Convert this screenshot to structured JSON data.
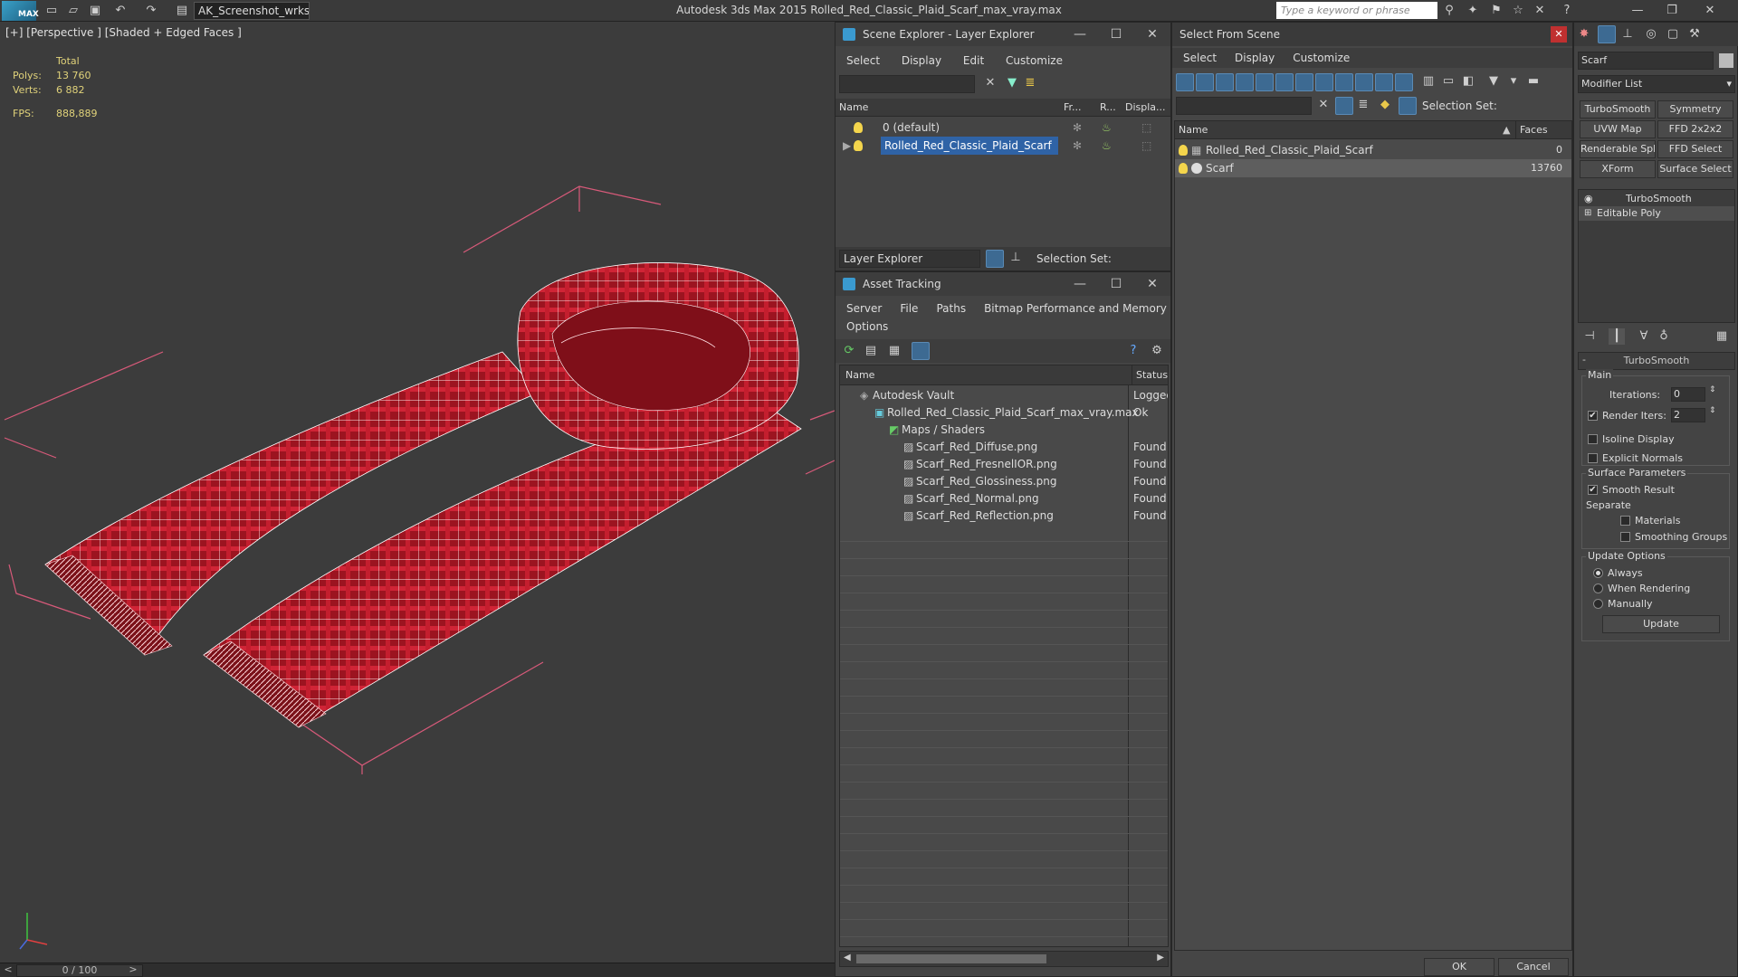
{
  "titlebar": {
    "workspace": "AK_Screenshot_wrksp",
    "title": "Autodesk 3ds Max  2015    Rolled_Red_Classic_Plaid_Scarf_max_vray.max",
    "search_placeholder": "Type a keyword or phrase"
  },
  "viewport": {
    "label": "[+] [Perspective ] [Shaded + Edged Faces ]",
    "stats": {
      "total_label": "Total",
      "polys_label": "Polys:",
      "polys_value": "13 760",
      "verts_label": "Verts:",
      "verts_value": "6 882",
      "fps_label": "FPS:",
      "fps_value": "888,889"
    },
    "timeline": "0 / 100"
  },
  "scene_explorer": {
    "title": "Scene Explorer - Layer Explorer",
    "menu": [
      "Select",
      "Display",
      "Edit",
      "Customize"
    ],
    "columns": [
      "Name",
      "Fr...",
      "R...",
      "Displa..."
    ],
    "rows": [
      {
        "name": "0 (default)"
      },
      {
        "name": "Rolled_Red_Classic_Plaid_Scarf"
      }
    ],
    "footer_dropdown": "Layer Explorer",
    "selection_set_label": "Selection Set:"
  },
  "asset_tracking": {
    "title": "Asset Tracking",
    "menu": [
      "Server",
      "File",
      "Paths",
      "Bitmap Performance and Memory",
      "Options"
    ],
    "columns": [
      "Name",
      "Status"
    ],
    "rows": [
      {
        "name": "Autodesk Vault",
        "status": "Logged"
      },
      {
        "name": "Rolled_Red_Classic_Plaid_Scarf_max_vray.max",
        "status": "Ok"
      },
      {
        "name": "Maps / Shaders",
        "status": ""
      },
      {
        "name": "Scarf_Red_Diffuse.png",
        "status": "Found"
      },
      {
        "name": "Scarf_Red_FresnelIOR.png",
        "status": "Found"
      },
      {
        "name": "Scarf_Red_Glossiness.png",
        "status": "Found"
      },
      {
        "name": "Scarf_Red_Normal.png",
        "status": "Found"
      },
      {
        "name": "Scarf_Red_Reflection.png",
        "status": "Found"
      }
    ]
  },
  "select_from_scene": {
    "title": "Select From Scene",
    "menu": [
      "Select",
      "Display",
      "Customize"
    ],
    "selection_set_label": "Selection Set:",
    "columns": [
      "Name",
      "Faces"
    ],
    "rows": [
      {
        "name": "Rolled_Red_Classic_Plaid_Scarf",
        "faces": "0"
      },
      {
        "name": "Scarf",
        "faces": "13760"
      }
    ],
    "ok": "OK",
    "cancel": "Cancel"
  },
  "command_panel": {
    "object_name": "Scarf",
    "modifier_list": "Modifier List",
    "modifier_buttons": [
      "TurboSmooth",
      "Symmetry",
      "UVW Map",
      "FFD 2x2x2",
      "Renderable Spline",
      "FFD Select",
      "XForm",
      "Surface Select"
    ],
    "stack": [
      "TurboSmooth",
      "Editable Poly"
    ],
    "rollout_title": "TurboSmooth",
    "main_label": "Main",
    "iterations_label": "Iterations:",
    "iterations_value": "0",
    "render_iters_label": "Render Iters:",
    "render_iters_value": "2",
    "isoline_display": "Isoline Display",
    "explicit_normals": "Explicit Normals",
    "surface_params": "Surface Parameters",
    "smooth_result": "Smooth Result",
    "separate": "Separate",
    "materials": "Materials",
    "smoothing_groups": "Smoothing Groups",
    "update_options": "Update Options",
    "always": "Always",
    "when_rendering": "When Rendering",
    "manually": "Manually",
    "update_button": "Update"
  }
}
